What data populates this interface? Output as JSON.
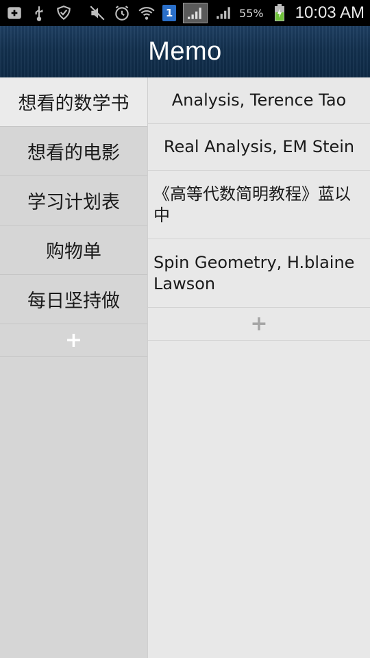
{
  "status_bar": {
    "left_icons": [
      "add-box-icon",
      "usb-icon",
      "shield-check-icon"
    ],
    "right_icons": [
      "mute-icon",
      "alarm-icon",
      "wifi-icon",
      "sim-badge-icon",
      "sim-signal-icon",
      "cell-signal-icon",
      "battery-charging-icon"
    ],
    "sim_badge": "1",
    "battery_percent": "55%",
    "time": "10:03 AM"
  },
  "app": {
    "title": "Memo"
  },
  "categories": {
    "items": [
      {
        "label": "想看的数学书",
        "selected": true
      },
      {
        "label": "想看的电影",
        "selected": false
      },
      {
        "label": "学习计划表",
        "selected": false
      },
      {
        "label": "购物单",
        "selected": false
      },
      {
        "label": "每日坚持做",
        "selected": false
      }
    ],
    "add_label": "+"
  },
  "memo_list": {
    "items": [
      {
        "text": "Analysis, Terence Tao"
      },
      {
        "text": "Real Analysis, EM Stein"
      },
      {
        "text": "《高等代数简明教程》蓝以中"
      },
      {
        "text": "Spin Geometry,  H.blaine Lawson"
      }
    ],
    "add_label": "+"
  },
  "colors": {
    "title_bar": "#13314f",
    "category_bg": "#d6d6d6",
    "selected_category_bg": "#ebebeb",
    "list_bg": "#e8e8e8"
  }
}
